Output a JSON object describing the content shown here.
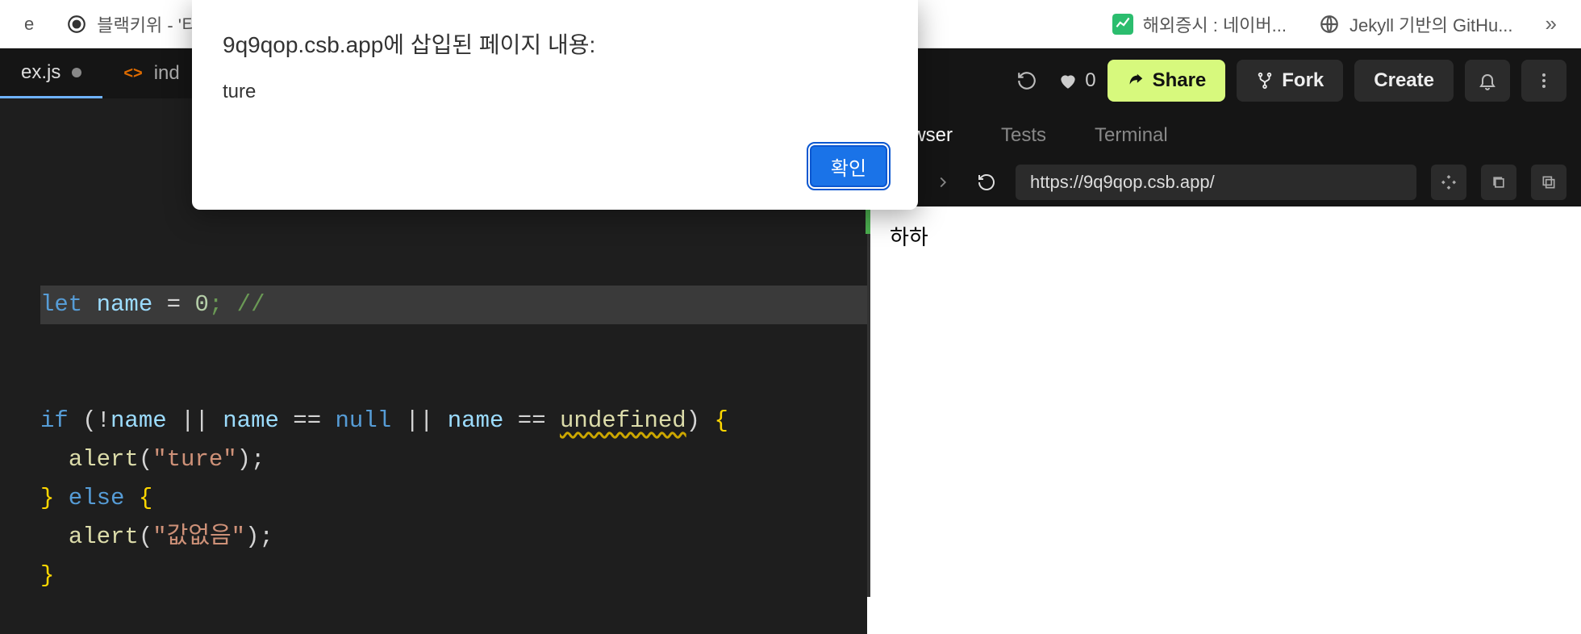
{
  "tabs": {
    "left_partial": "e",
    "blackkiwi": "블랙키위 - '티",
    "naver_stock": "해외증시 : 네이버...",
    "jekyll": "Jekyll 기반의 GitHu..."
  },
  "sandbox": {
    "editor_tabs": {
      "active_partial": "ex.js",
      "second_partial": "ind"
    },
    "topbar": {
      "likes": "0",
      "share": "Share",
      "fork": "Fork",
      "create": "Create"
    },
    "panel_tabs": {
      "browser_partial": "rowser",
      "tests": "Tests",
      "terminal": "Terminal"
    },
    "url": "https://9q9qop.csb.app/",
    "preview_text": "하하",
    "code": {
      "l1_let": "let",
      "l1_name": "name",
      "l1_eq": " = ",
      "l1_zero": "0",
      "l1_tail": "; //",
      "l2_if": "if",
      "l2_open": " (",
      "l2_bang": "!",
      "l2_n1": "name",
      "l2_or1": " ||",
      "l2_n2": "name",
      "l2_eq1": " ==",
      "l2_null": "null",
      "l2_or2": " ||",
      "l2_n3": "name",
      "l2_eq2": " ==",
      "l2_undef": "undefined",
      "l2_close": ") ",
      "l2_brace": "{",
      "l3_alert": "alert",
      "l3_open": "(",
      "l3_str": "\"ture\"",
      "l3_close": ");",
      "l4_close": "}",
      "l4_else": " else ",
      "l4_brace": "{",
      "l5_alert": "alert",
      "l5_open": "(",
      "l5_str": "\"값없음\"",
      "l5_close": ");",
      "l6_close": "}"
    }
  },
  "alert": {
    "header": "9q9qop.csb.app에 삽입된 페이지 내용:",
    "body": "ture",
    "ok": "확인"
  }
}
